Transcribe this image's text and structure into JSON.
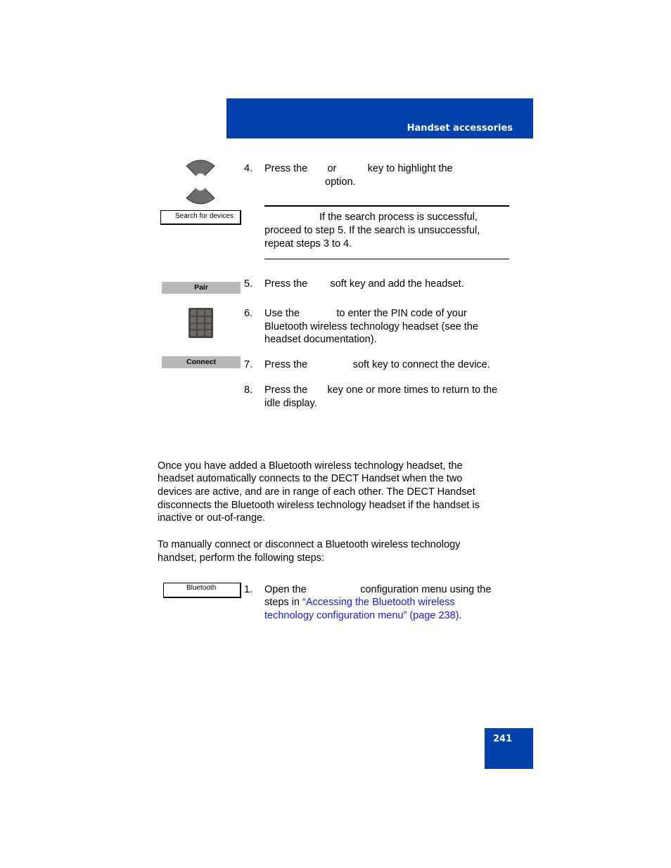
{
  "header": {
    "section_title": "Handset accessories"
  },
  "page_number": "241",
  "icons": {
    "nav_up": "nav-up-key-icon",
    "nav_down": "nav-down-key-icon",
    "keypad": "dialpad-icon"
  },
  "menu_labels": {
    "search_for_devices": "Search for devices",
    "bluetooth": "Bluetooth"
  },
  "softkeys": {
    "pair": "Pair",
    "connect": "Connect"
  },
  "steps_add": [
    {
      "number": "4.",
      "lines": [
        "Press the       or           key to highlight the",
        "option."
      ]
    },
    {
      "number": "5.",
      "lines": [
        "Press the        soft key and add the headset."
      ]
    },
    {
      "number": "6.",
      "lines": [
        "Use the             to enter the PIN code of your",
        "Bluetooth wireless technology headset (see the",
        "headset documentation)."
      ]
    },
    {
      "number": "7.",
      "lines": [
        "Press the                soft key to connect the device."
      ]
    },
    {
      "number": "8.",
      "lines": [
        "Press the       key one or more times to return to the",
        "idle display."
      ]
    }
  ],
  "note": {
    "lines": [
      "If the search process is successful,",
      "proceed to step 5. If the search is unsuccessful,",
      "repeat steps 3 to 4."
    ]
  },
  "body_paragraphs": [
    [
      "Once you have added a Bluetooth wireless technology headset, the",
      "headset automatically connects to the DECT Handset when the two",
      "devices are active, and are in range of each other. The DECT Handset",
      "disconnects the Bluetooth wireless technology headset if the handset is",
      "inactive or out-of-range."
    ],
    [
      "To manually connect or disconnect a Bluetooth wireless technology",
      "handset, perform the following steps:"
    ]
  ],
  "steps_connect": [
    {
      "number": "1.",
      "line1": "Open the                   configuration menu using the",
      "line2_prefix": "steps in ",
      "link_line1": "“Accessing the Bluetooth wireless",
      "link_line2": "technology configuration menu” (page 238)",
      "suffix": "."
    }
  ],
  "colors": {
    "brand_blue": "#0041ae",
    "link_blue": "#1a1ae6",
    "softkey_gray": "#b8b8b8"
  }
}
